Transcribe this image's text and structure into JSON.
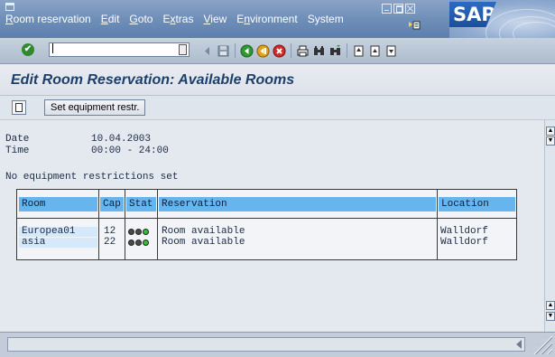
{
  "menu": {
    "items": [
      {
        "label": "Room reservation",
        "underline_index": 0
      },
      {
        "label": "Edit",
        "underline_index": 0
      },
      {
        "label": "Goto",
        "underline_index": 0
      },
      {
        "label": "Extras",
        "underline_index": 1
      },
      {
        "label": "View",
        "underline_index": 0
      },
      {
        "label": "Environment",
        "underline_index": 1
      },
      {
        "label": "System",
        "underline_index": -1
      }
    ]
  },
  "brand": {
    "logo_text": "SAP",
    "logo_color": "#1c4f9c"
  },
  "toolbar": {
    "command_value": ""
  },
  "page": {
    "title": "Edit Room Reservation: Available Rooms"
  },
  "app_toolbar": {
    "equip_button_label": "Set equipment restr."
  },
  "header_fields": {
    "date_label": "Date",
    "date_value": "10.04.2003",
    "time_label": "Time",
    "time_value": "00:00 - 24:00",
    "restriction_text": "No equipment restrictions set"
  },
  "table": {
    "columns": [
      "Room",
      "Cap",
      "Stat",
      "Reservation",
      "Location"
    ],
    "rows": [
      {
        "room": "Europea01",
        "cap": "12",
        "status": "green",
        "reservation": "Room available",
        "location": "Walldorf"
      },
      {
        "room": "asia",
        "cap": "22",
        "status": "green",
        "reservation": "Room available",
        "location": "Walldorf"
      }
    ]
  },
  "colors": {
    "header_cell": "#67b5ee",
    "title_text": "#1f3f6b",
    "light_on": "#2fc12f",
    "light_off": "#4a4a4a"
  }
}
